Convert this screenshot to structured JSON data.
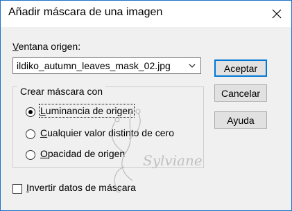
{
  "dialog": {
    "title": "Añadir máscara de una imagen",
    "close_icon": "close-icon"
  },
  "source": {
    "label_accel": "V",
    "label_rest": "entana origen:",
    "selected_value": "ildiko_autumn_leaves_mask_02.jpg"
  },
  "group": {
    "legend": "Crear máscara con",
    "options": [
      {
        "accel": "L",
        "rest": "uminancia de origen",
        "checked": true
      },
      {
        "accel": "C",
        "rest": "ualquier valor distinto de cero",
        "checked": false
      },
      {
        "accel": "O",
        "rest": "pacidad de origen",
        "checked": false
      }
    ]
  },
  "invert": {
    "accel": "I",
    "rest": "nvertir datos de máscara",
    "checked": false
  },
  "buttons": {
    "accept": "Aceptar",
    "cancel": "Cancelar",
    "help": "Ayuda"
  },
  "watermark": {
    "text": "Sylviane"
  }
}
